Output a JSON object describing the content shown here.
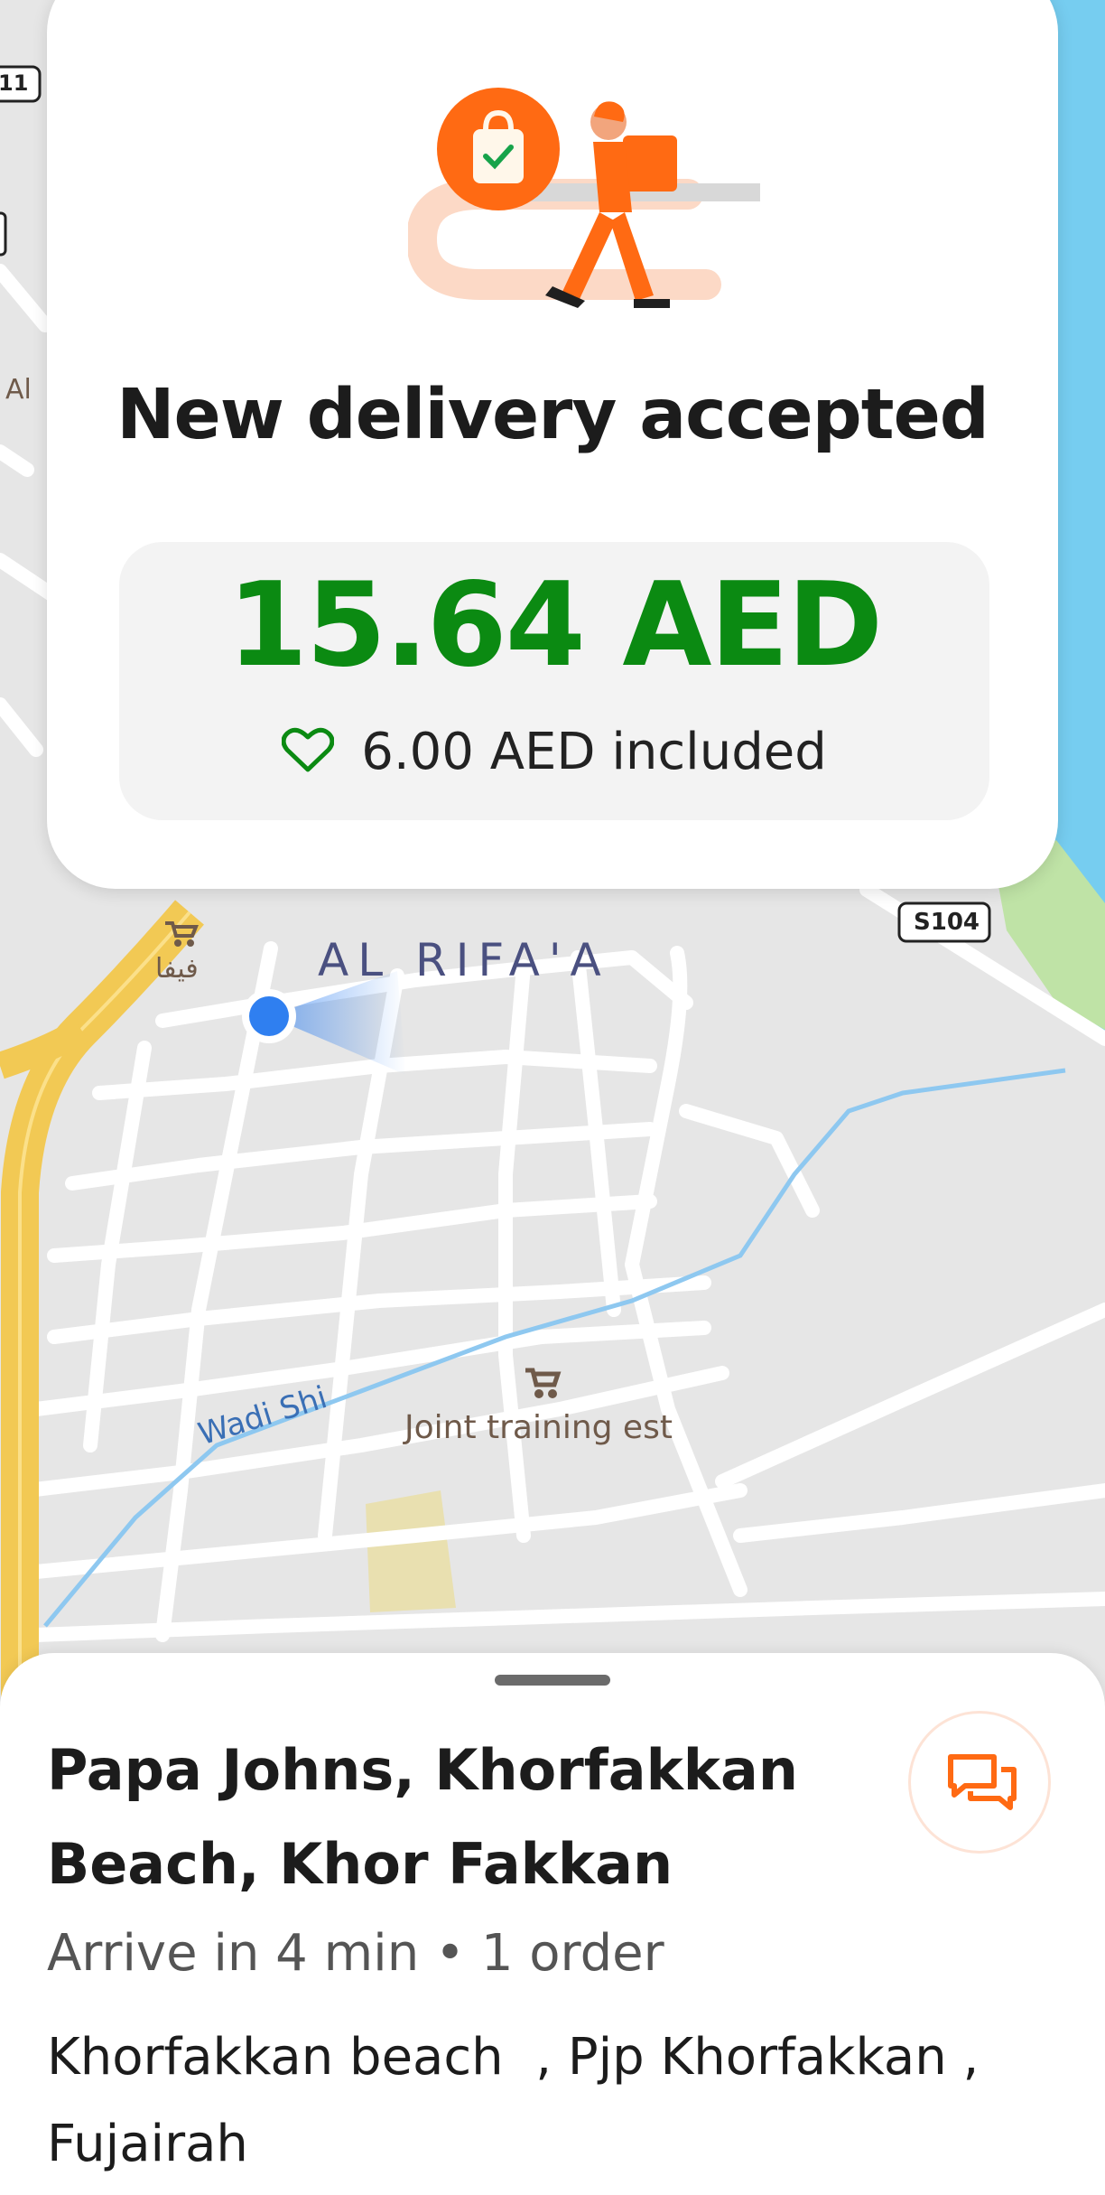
{
  "map": {
    "labels": {
      "route_badge_left": "11",
      "edge_left": "Al",
      "store_arabic": "فيفا",
      "district": "AL RIFA'A",
      "route_badge_right": "S104",
      "wadi": "Wadi Shi",
      "poi": "Joint training est"
    },
    "colors": {
      "land": "#e6e6e6",
      "road": "#ffffff",
      "highway": "#f2c954",
      "water": "#76cdf0",
      "park": "#bfe3a6",
      "wadi_line": "#8ec8f0",
      "location_dot": "#2f7ff0",
      "poi_brown": "#6f5a4a"
    },
    "icons": [
      "cart-icon",
      "location-dot-icon"
    ]
  },
  "accept_card": {
    "title": "New delivery accepted",
    "earnings": "15.64 AED",
    "tip_text": "6.00 AED included",
    "icons": [
      "delivery-courier-illustration",
      "heart-outline-icon"
    ],
    "colors": {
      "earnings": "#0b8a12",
      "accent": "#ff6a13"
    }
  },
  "bottom_sheet": {
    "restaurant_line1": "Papa Johns, Khorfakkan",
    "restaurant_line2": "Beach, Khor Fakkan",
    "arrive_info": "Arrive in 4 min • 1 order",
    "address_line1": "Khorfakkan beach  , Pjp Khorfakkan ,",
    "address_line2": "Fujairah",
    "icons": [
      "chat-icon"
    ]
  }
}
